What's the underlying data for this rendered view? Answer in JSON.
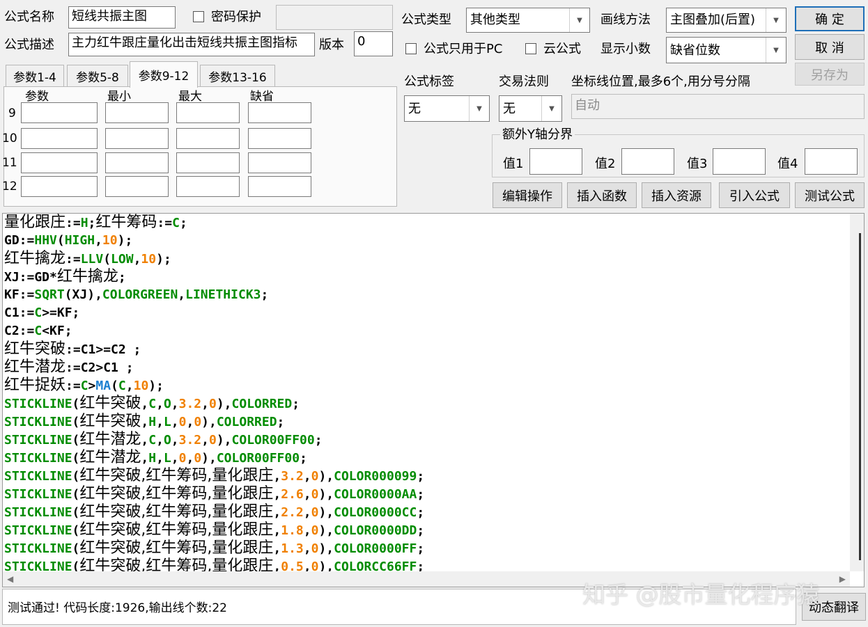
{
  "header": {
    "name_label": "公式名称",
    "name_value": "短线共振主图",
    "password_label": "密码保护",
    "password_value": "",
    "desc_label": "公式描述",
    "desc_value": "主力红牛跟庄量化出击短线共振主图指标",
    "version_label": "版本",
    "version_value": "0",
    "type_label": "公式类型",
    "type_value": "其他类型",
    "draw_label": "画线方法",
    "draw_value": "主图叠加(后置)",
    "pc_only_label": "公式只用于PC",
    "cloud_label": "云公式",
    "decimals_label": "显示小数",
    "decimals_value": "缺省位数",
    "tag_label": "公式标签",
    "tag_value": "无",
    "rule_label": "交易法则",
    "rule_value": "无",
    "coord_label": "坐标线位置,最多6个,用分号分隔",
    "coord_value": "自动"
  },
  "buttons": {
    "ok": "确  定",
    "cancel": "取  消",
    "save_as": "另存为",
    "edit_op": "编辑操作",
    "insert_func": "插入函数",
    "insert_res": "插入资源",
    "import_formula": "引入公式",
    "test_formula": "测试公式",
    "dynamic_translate": "动态翻译"
  },
  "tabs": [
    {
      "label": "参数1-4"
    },
    {
      "label": "参数5-8"
    },
    {
      "label": "参数9-12"
    },
    {
      "label": "参数13-16"
    }
  ],
  "params": {
    "columns": [
      "参数",
      "最小",
      "最大",
      "缺省"
    ],
    "rows": [
      "9",
      "10",
      "11",
      "12"
    ]
  },
  "yaxis": {
    "title": "额外Y轴分界",
    "labels": [
      "值1",
      "值2",
      "值3",
      "值4"
    ]
  },
  "code_lines": [
    [
      [
        "cj",
        "量化跟庄"
      ],
      [
        "k",
        ":="
      ],
      [
        "g",
        "H"
      ],
      [
        "k",
        ";"
      ],
      [
        "cj",
        "红牛筹码"
      ],
      [
        "k",
        ":="
      ],
      [
        "g",
        "C"
      ],
      [
        "k",
        ";"
      ]
    ],
    [
      [
        "k",
        "GD:="
      ],
      [
        "g",
        "HHV"
      ],
      [
        "k",
        "("
      ],
      [
        "g",
        "HIGH"
      ],
      [
        "k",
        ","
      ],
      [
        "o",
        "10"
      ],
      [
        "k",
        ");"
      ]
    ],
    [
      [
        "cj",
        "红牛擒龙"
      ],
      [
        "k",
        ":="
      ],
      [
        "g",
        "LLV"
      ],
      [
        "k",
        "("
      ],
      [
        "g",
        "LOW"
      ],
      [
        "k",
        ","
      ],
      [
        "o",
        "10"
      ],
      [
        "k",
        ");"
      ]
    ],
    [
      [
        "k",
        "XJ:=GD*"
      ],
      [
        "cj",
        "红牛擒龙"
      ],
      [
        "k",
        ";"
      ]
    ],
    [
      [
        "k",
        "KF:="
      ],
      [
        "g",
        "SQRT"
      ],
      [
        "k",
        "(XJ),"
      ],
      [
        "g",
        "COLORGREEN"
      ],
      [
        "k",
        ","
      ],
      [
        "g",
        "LINETHICK3"
      ],
      [
        "k",
        ";"
      ]
    ],
    [
      [
        "k",
        "C1:="
      ],
      [
        "g",
        "C"
      ],
      [
        "k",
        ">=KF;"
      ]
    ],
    [
      [
        "k",
        "C2:="
      ],
      [
        "g",
        "C"
      ],
      [
        "k",
        "<KF;"
      ]
    ],
    [
      [
        "cj",
        "红牛突破"
      ],
      [
        "k",
        ":=C1>=C2 ;"
      ]
    ],
    [
      [
        "cj",
        "红牛潜龙"
      ],
      [
        "k",
        ":=C2>C1 ;"
      ]
    ],
    [
      [
        "cj",
        "红牛捉妖"
      ],
      [
        "k",
        ":="
      ],
      [
        "g",
        "C"
      ],
      [
        "k",
        ">"
      ],
      [
        "b",
        "MA"
      ],
      [
        "k",
        "("
      ],
      [
        "g",
        "C"
      ],
      [
        "k",
        ","
      ],
      [
        "o",
        "10"
      ],
      [
        "k",
        ");"
      ]
    ],
    [
      [
        "g",
        "STICKLINE"
      ],
      [
        "k",
        "("
      ],
      [
        "cj",
        "红牛突破"
      ],
      [
        "k",
        ","
      ],
      [
        "g",
        "C"
      ],
      [
        "k",
        ","
      ],
      [
        "g",
        "O"
      ],
      [
        "k",
        ","
      ],
      [
        "o",
        "3.2"
      ],
      [
        "k",
        ","
      ],
      [
        "o",
        "0"
      ],
      [
        "k",
        "),"
      ],
      [
        "g",
        "COLORRED"
      ],
      [
        "k",
        ";"
      ]
    ],
    [
      [
        "g",
        "STICKLINE"
      ],
      [
        "k",
        "("
      ],
      [
        "cj",
        "红牛突破"
      ],
      [
        "k",
        ","
      ],
      [
        "g",
        "H"
      ],
      [
        "k",
        ","
      ],
      [
        "g",
        "L"
      ],
      [
        "k",
        ","
      ],
      [
        "o",
        "0"
      ],
      [
        "k",
        ","
      ],
      [
        "o",
        "0"
      ],
      [
        "k",
        "),"
      ],
      [
        "g",
        "COLORRED"
      ],
      [
        "k",
        ";"
      ]
    ],
    [
      [
        "g",
        "STICKLINE"
      ],
      [
        "k",
        "("
      ],
      [
        "cj",
        "红牛潜龙"
      ],
      [
        "k",
        ","
      ],
      [
        "g",
        "C"
      ],
      [
        "k",
        ","
      ],
      [
        "g",
        "O"
      ],
      [
        "k",
        ","
      ],
      [
        "o",
        "3.2"
      ],
      [
        "k",
        ","
      ],
      [
        "o",
        "0"
      ],
      [
        "k",
        "),"
      ],
      [
        "g",
        "COLOR00FF00"
      ],
      [
        "k",
        ";"
      ]
    ],
    [
      [
        "g",
        "STICKLINE"
      ],
      [
        "k",
        "("
      ],
      [
        "cj",
        "红牛潜龙"
      ],
      [
        "k",
        ","
      ],
      [
        "g",
        "H"
      ],
      [
        "k",
        ","
      ],
      [
        "g",
        "L"
      ],
      [
        "k",
        ","
      ],
      [
        "o",
        "0"
      ],
      [
        "k",
        ","
      ],
      [
        "o",
        "0"
      ],
      [
        "k",
        "),"
      ],
      [
        "g",
        "COLOR00FF00"
      ],
      [
        "k",
        ";"
      ]
    ],
    [
      [
        "g",
        "STICKLINE"
      ],
      [
        "k",
        "("
      ],
      [
        "cj",
        "红牛突破,红牛筹码,量化跟庄"
      ],
      [
        "k",
        ","
      ],
      [
        "o",
        "3.2"
      ],
      [
        "k",
        ","
      ],
      [
        "o",
        "0"
      ],
      [
        "k",
        "),"
      ],
      [
        "g",
        "COLOR000099"
      ],
      [
        "k",
        ";"
      ]
    ],
    [
      [
        "g",
        "STICKLINE"
      ],
      [
        "k",
        "("
      ],
      [
        "cj",
        "红牛突破,红牛筹码,量化跟庄"
      ],
      [
        "k",
        ","
      ],
      [
        "o",
        "2.6"
      ],
      [
        "k",
        ","
      ],
      [
        "o",
        "0"
      ],
      [
        "k",
        "),"
      ],
      [
        "g",
        "COLOR0000AA"
      ],
      [
        "k",
        ";"
      ]
    ],
    [
      [
        "g",
        "STICKLINE"
      ],
      [
        "k",
        "("
      ],
      [
        "cj",
        "红牛突破,红牛筹码,量化跟庄"
      ],
      [
        "k",
        ","
      ],
      [
        "o",
        "2.2"
      ],
      [
        "k",
        ","
      ],
      [
        "o",
        "0"
      ],
      [
        "k",
        "),"
      ],
      [
        "g",
        "COLOR0000CC"
      ],
      [
        "k",
        ";"
      ]
    ],
    [
      [
        "g",
        "STICKLINE"
      ],
      [
        "k",
        "("
      ],
      [
        "cj",
        "红牛突破,红牛筹码,量化跟庄"
      ],
      [
        "k",
        ","
      ],
      [
        "o",
        "1.8"
      ],
      [
        "k",
        ","
      ],
      [
        "o",
        "0"
      ],
      [
        "k",
        "),"
      ],
      [
        "g",
        "COLOR0000DD"
      ],
      [
        "k",
        ";"
      ]
    ],
    [
      [
        "g",
        "STICKLINE"
      ],
      [
        "k",
        "("
      ],
      [
        "cj",
        "红牛突破,红牛筹码,量化跟庄"
      ],
      [
        "k",
        ","
      ],
      [
        "o",
        "1.3"
      ],
      [
        "k",
        ","
      ],
      [
        "o",
        "0"
      ],
      [
        "k",
        "),"
      ],
      [
        "g",
        "COLOR0000FF"
      ],
      [
        "k",
        ";"
      ]
    ],
    [
      [
        "g",
        "STICKLINE"
      ],
      [
        "k",
        "("
      ],
      [
        "cj",
        "红牛突破,红牛筹码,量化跟庄"
      ],
      [
        "k",
        ","
      ],
      [
        "o",
        "0.5"
      ],
      [
        "k",
        ","
      ],
      [
        "o",
        "0"
      ],
      [
        "k",
        "),"
      ],
      [
        "g",
        "COLORCC66FF"
      ],
      [
        "k",
        ";"
      ]
    ]
  ],
  "status": {
    "message": "测试通过! 代码长度:1926,输出线个数:22"
  },
  "watermark": "知乎 @股市量化程序猿"
}
